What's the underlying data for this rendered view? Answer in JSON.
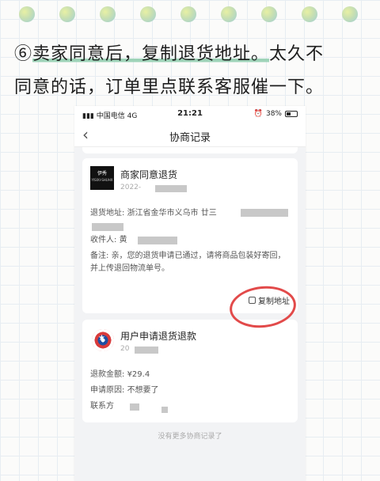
{
  "caption": {
    "line1_prefix": "⑥",
    "line1_highlight": "卖家同意后，复制退货地址。",
    "line1_suffix": "太久不",
    "line2": "同意的话，订单里点联系客服催一下。"
  },
  "status_bar": {
    "carrier": "中国电信",
    "network": "4G",
    "time": "21:21",
    "battery": "38%"
  },
  "nav": {
    "back_icon": "chevron-left-icon",
    "title": "协商记录"
  },
  "card1": {
    "logo_text": "伊秀",
    "logo_sub": "YISIXI-SHUHX",
    "title": "商家同意退货",
    "date": "2022-",
    "address_label": "退货地址:",
    "address_value": "浙江省金华市义乌市 廿三",
    "recipient_label": "收件人:",
    "recipient_value": "黄",
    "note_label": "备注:",
    "note_value": "亲，您的退货申请已通过，请将商品包装好寄回，并上传退回物流单号。",
    "copy_button": "复制地址",
    "copy_icon": "copy-icon"
  },
  "card2": {
    "title": "用户申请退货退款",
    "date": "20",
    "amount_label": "退款金额:",
    "amount_value": "¥29.4",
    "reason_label": "申请原因:",
    "reason_value": "不想要了",
    "contact_label": "联系方"
  },
  "footer": {
    "end_text": "没有更多协商记录了"
  }
}
